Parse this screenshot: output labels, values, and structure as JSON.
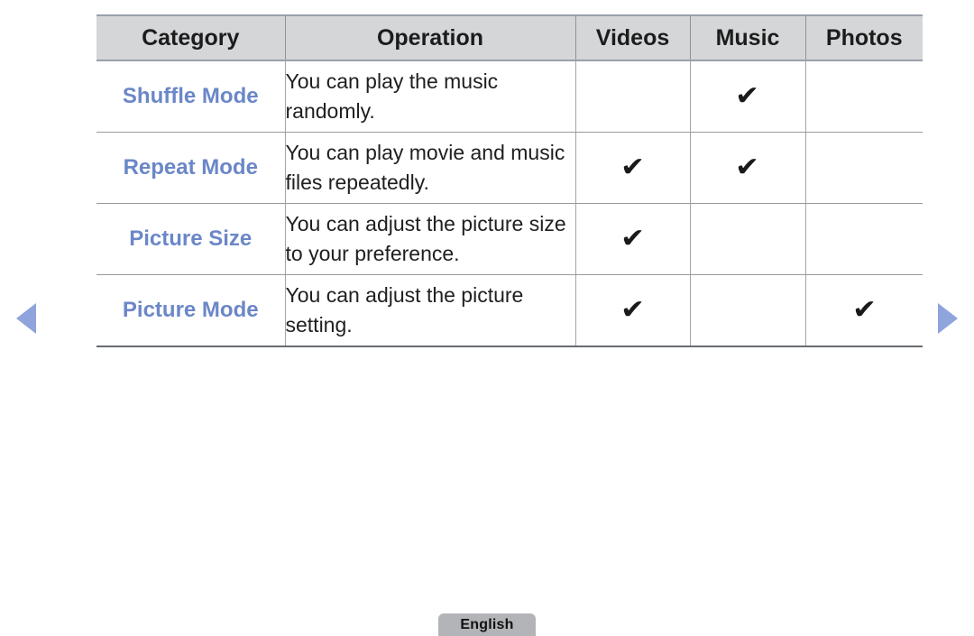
{
  "nav": {
    "prev_label": "previous page",
    "prev_icon": "triangle-left-icon",
    "next_label": "next page",
    "next_icon": "triangle-right-icon",
    "arrow_color": "#8fa4dd"
  },
  "table": {
    "headers": [
      "Category",
      "Operation",
      "Videos",
      "Music",
      "Photos"
    ],
    "header_bg": "#d4d6d8",
    "category_color": "#6b87c8",
    "check_glyph": "✔",
    "rows": [
      {
        "category": "Shuffle Mode",
        "operation": "You can play the music randomly.",
        "videos": "",
        "music": "✔",
        "photos": ""
      },
      {
        "category": "Repeat Mode",
        "operation": "You can play movie and music files repeatedly.",
        "videos": "✔",
        "music": "✔",
        "photos": ""
      },
      {
        "category": "Picture Size",
        "operation": "You can adjust the picture size to your preference.",
        "videos": "✔",
        "music": "",
        "photos": ""
      },
      {
        "category": "Picture Mode",
        "operation": "You can adjust the picture setting.",
        "videos": "✔",
        "music": "",
        "photos": "✔"
      }
    ]
  },
  "footer": {
    "language_label": "English"
  }
}
